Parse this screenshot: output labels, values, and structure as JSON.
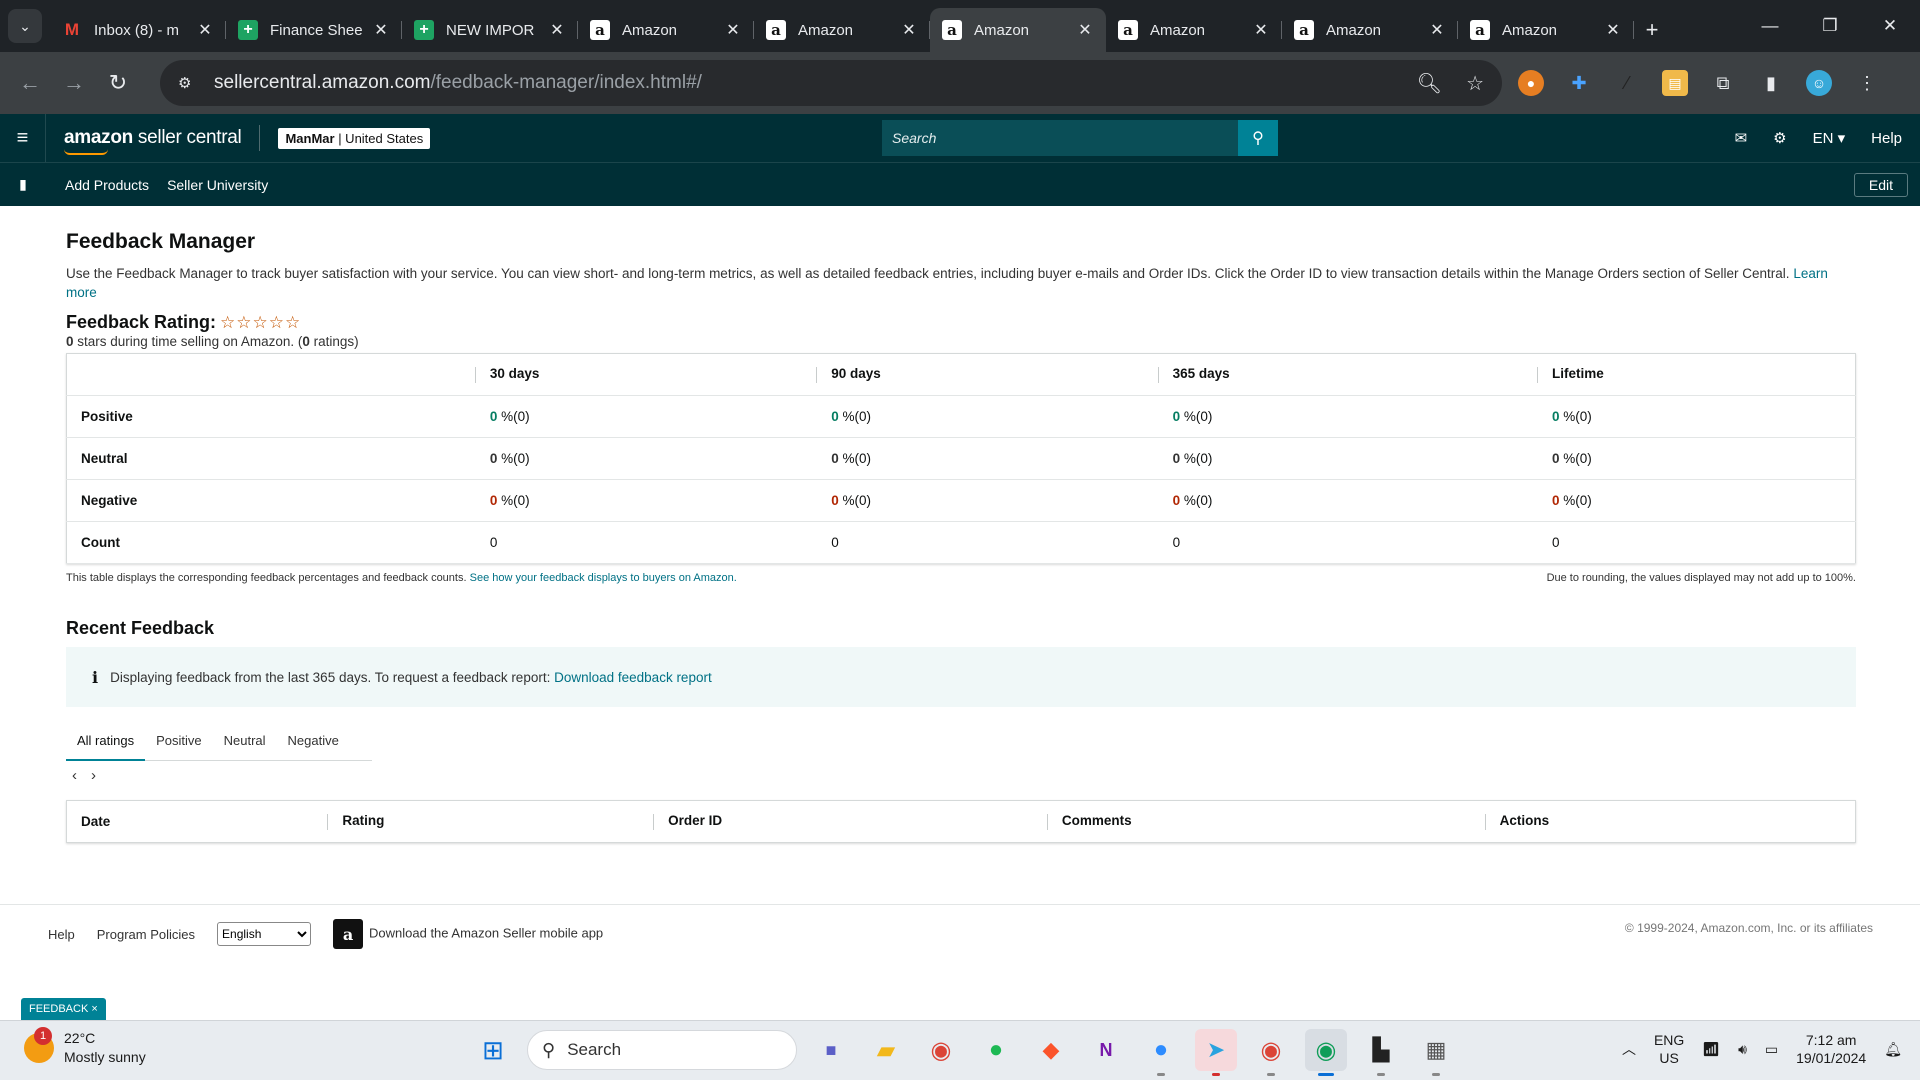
{
  "browser": {
    "tabs": [
      {
        "title": "Inbox (8) - m",
        "icon": "gmail-icon"
      },
      {
        "title": "Finance Shee",
        "icon": "sheets-icon"
      },
      {
        "title": "NEW IMPOR",
        "icon": "sheets-icon"
      },
      {
        "title": "Amazon",
        "icon": "amazon-icon"
      },
      {
        "title": "Amazon",
        "icon": "amazon-icon"
      },
      {
        "title": "Amazon",
        "icon": "amazon-icon",
        "active": true
      },
      {
        "title": "Amazon",
        "icon": "amazon-icon"
      },
      {
        "title": "Amazon",
        "icon": "amazon-icon"
      },
      {
        "title": "Amazon",
        "icon": "amazon-icon"
      }
    ],
    "url_host": "sellercentral.amazon.com",
    "url_path": "/feedback-manager/index.html#/"
  },
  "header": {
    "logo_bold": "amazon",
    "logo_light": " seller central",
    "store_name": "ManMar",
    "store_region": " | United States",
    "search_placeholder": "Search",
    "lang": "EN",
    "help": "Help",
    "sub_links": [
      "Add Products",
      "Seller University"
    ],
    "edit": "Edit"
  },
  "page": {
    "title": "Feedback Manager",
    "description": "Use the Feedback Manager to track buyer satisfaction with your service. You can view short- and long-term metrics, as well as detailed feedback entries, including buyer e-mails and Order IDs. Click the Order ID to view transaction details within the Manage Orders section of Seller Central.",
    "learn_more": "Learn more",
    "rating_label": "Feedback Rating:",
    "stars_filled": 0,
    "stars_total": 5,
    "stars_value": "0",
    "stars_text": " stars during time selling on Amazon. (",
    "ratings_count": "0",
    "ratings_text": " ratings)"
  },
  "feedback_table": {
    "columns": [
      "30 days",
      "90 days",
      "365 days",
      "Lifetime"
    ],
    "rows": [
      {
        "label": "Positive",
        "class": "g",
        "cells": [
          {
            "v": "0",
            "s": " %(0)"
          },
          {
            "v": "0",
            "s": " %(0)"
          },
          {
            "v": "0",
            "s": " %(0)"
          },
          {
            "v": "0",
            "s": " %(0)"
          }
        ]
      },
      {
        "label": "Neutral",
        "class": "n",
        "cells": [
          {
            "v": "0",
            "s": " %(0)"
          },
          {
            "v": "0",
            "s": " %(0)"
          },
          {
            "v": "0",
            "s": " %(0)"
          },
          {
            "v": "0",
            "s": " %(0)"
          }
        ]
      },
      {
        "label": "Negative",
        "class": "r",
        "cells": [
          {
            "v": "0",
            "s": " %(0)"
          },
          {
            "v": "0",
            "s": " %(0)"
          },
          {
            "v": "0",
            "s": " %(0)"
          },
          {
            "v": "0",
            "s": " %(0)"
          }
        ]
      },
      {
        "label": "Count",
        "class": "",
        "cells": [
          {
            "v": "0",
            "s": ""
          },
          {
            "v": "0",
            "s": ""
          },
          {
            "v": "0",
            "s": ""
          },
          {
            "v": "0",
            "s": ""
          }
        ]
      }
    ],
    "note_left": "This table displays the corresponding feedback percentages and feedback counts.",
    "note_link": "See how your feedback displays to buyers on Amazon.",
    "note_right": "Due to rounding, the values displayed may not add up to 100%."
  },
  "recent": {
    "title": "Recent Feedback",
    "info_text": "Displaying feedback from the last 365 days. To request a feedback report:",
    "info_link": "Download feedback report",
    "tabs": [
      "All ratings",
      "Positive",
      "Neutral",
      "Negative"
    ],
    "columns": [
      "Date",
      "Rating",
      "Order ID",
      "Comments",
      "Actions"
    ]
  },
  "footer": {
    "help": "Help",
    "policies": "Program Policies",
    "language": "English",
    "app": "Download the Amazon Seller mobile app",
    "copyright": "© 1999-2024, Amazon.com, Inc. or its affiliates",
    "chip": "FEEDBACK"
  },
  "taskbar": {
    "temp": "22°C",
    "weather": "Mostly sunny",
    "weather_badge": "1",
    "search": "Search",
    "lang1": "ENG",
    "lang2": "US",
    "time": "7:12 am",
    "date": "19/01/2024"
  },
  "colors": {
    "header_bg": "#002f36",
    "accent": "#008296",
    "positive": "#067d62",
    "negative": "#b12704",
    "link": "#007185"
  }
}
